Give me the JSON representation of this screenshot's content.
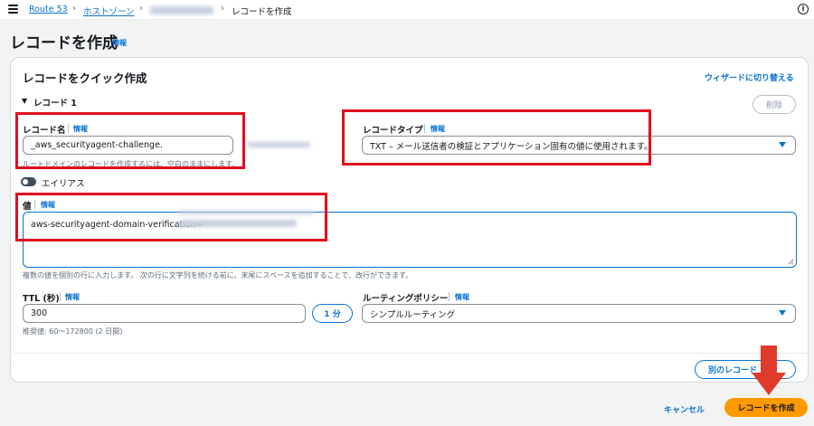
{
  "breadcrumb": {
    "items": [
      "Route 53",
      "ホストゾーン"
    ],
    "current": "レコードを作成"
  },
  "page": {
    "title": "レコードを作成",
    "info": "情報"
  },
  "card": {
    "title": "レコードをクイック作成",
    "wizard_link": "ウィザードに切り替える",
    "record_group": "レコード 1",
    "delete_button": "削除"
  },
  "record_name": {
    "label": "レコード名",
    "info": "情報",
    "value": "_aws_securityagent-challenge.",
    "hint": "ルートドメインのレコードを作成するには、空白のままにします。"
  },
  "record_type": {
    "label": "レコードタイプ",
    "info": "情報",
    "value": "TXT – メール送信者の検証とアプリケーション固有の値に使用されます。"
  },
  "alias": {
    "label": "エイリアス"
  },
  "value_field": {
    "label": "値",
    "info": "情報",
    "value": "aws-securityagent-domain-verification=",
    "hint": "複数の値を個別の行に入力します。 次の行に文字列を続ける前に、末尾にスペースを追加することで、改行ができます。"
  },
  "ttl": {
    "label": "TTL (秒)",
    "info": "情報",
    "value": "300",
    "preset_button": "1 分",
    "hint": "推奨値: 60～172800 (2 日間)"
  },
  "routing_policy": {
    "label": "ルーティングポリシー",
    "info": "情報",
    "value": "シンプルルーティング"
  },
  "add_record_button": "別のレコード",
  "footer": {
    "cancel": "キャンセル",
    "create": "レコードを作成"
  },
  "colors": {
    "accent": "#0972d3",
    "primary_button": "#ff9900",
    "highlight_box": "#e01020",
    "arrow": "#e03a2a"
  },
  "icons": {
    "menu": "hamburger-menu-icon",
    "info": "info-circle-icon",
    "caret": "caret-down-icon",
    "expand": "triangle-down-icon",
    "arrow": "red-down-arrow-icon"
  }
}
